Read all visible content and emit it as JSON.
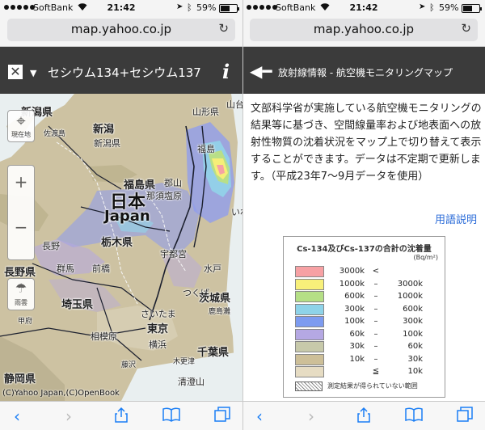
{
  "status": {
    "carrier": "SoftBank",
    "time": "21:42",
    "battery": "59%",
    "battery_level": 0.59
  },
  "browser": {
    "url": "map.yahoo.co.jp"
  },
  "map_screen": {
    "title": "セシウム134+セシウム137",
    "info_label": "i",
    "controls": {
      "locate_label": "現在地",
      "rain_label": "雨雲"
    },
    "labels": {
      "niigata_pref": "新潟県",
      "sado": "佐渡島",
      "niigata": "新潟",
      "yamagata": "山形県",
      "yamagata_city": "山台",
      "fukushima_city": "福島",
      "fukushima_pref": "福島県",
      "koriyama": "郡山",
      "nasushiobara": "那須塩原",
      "japan_kanji": "日本",
      "japan_latin": "Japan",
      "iwaki": "いわ",
      "nagano": "長野",
      "tochigi": "栃木県",
      "utsunomiya": "宇都宮",
      "mito": "水戸",
      "maebashi": "前橋",
      "nagano_pref": "長野県",
      "gunma": "群馬",
      "tsukuba": "つくば",
      "ibaraki": "茨城県",
      "kashimanada": "鹿島灘",
      "saitama_pref": "埼玉県",
      "saitama": "さいたま",
      "tokyo": "東京",
      "kofu": "甲府",
      "sagamihara": "相模原",
      "yokohama": "横浜",
      "chiba": "千葉県",
      "fujisawa": "藤沢",
      "kisarazu": "木更津",
      "shizuoka": "静岡県",
      "tateyama": "清澄山",
      "copyright": "(C)Yahoo Japan,(C)OpenBook"
    }
  },
  "info_panel": {
    "title": "放射線情報 - 航空機モニタリングマップ",
    "description": "文部科学省が実施している航空機モニタリングの結果等に基づき、空間線量率および地表面への放射性物質の沈着状況をマップ上で切り替えて表示することができます。データは不定期で更新します。（平成23年7〜9月データを使用）",
    "terms_link": "用語説明",
    "legend": {
      "title": "Cs-134及びCs-137の合計の沈着量",
      "unit": "(Bq/m²)",
      "rows": [
        {
          "from": "3000k",
          "sep": "<",
          "to": "",
          "color": "#f7a1a4"
        },
        {
          "from": "1000k",
          "sep": "–",
          "to": "3000k",
          "color": "#f8f07a"
        },
        {
          "from": "600k",
          "sep": "–",
          "to": "1000k",
          "color": "#b5df86"
        },
        {
          "from": "300k",
          "sep": "–",
          "to": "600k",
          "color": "#8ed3e9"
        },
        {
          "from": "100k",
          "sep": "–",
          "to": "300k",
          "color": "#7d9bf0"
        },
        {
          "from": "60k",
          "sep": "–",
          "to": "100k",
          "color": "#b5a8e3"
        },
        {
          "from": "30k",
          "sep": "–",
          "to": "60k",
          "color": "#c7c9aa"
        },
        {
          "from": "10k",
          "sep": "–",
          "to": "30k",
          "color": "#cdbf98"
        },
        {
          "from": "",
          "sep": "≦",
          "to": "10k",
          "color": "#e6dcc3"
        }
      ],
      "no_data_text": "測定結果が得られていない範囲"
    }
  },
  "icons": {
    "left_toolbar": [
      "back-icon",
      "forward-icon",
      "share-icon",
      "bookmarks-icon",
      "tabs-icon"
    ],
    "right_toolbar": [
      "back-icon",
      "forward-icon",
      "share-icon",
      "bookmarks-icon",
      "tabs-icon"
    ]
  }
}
